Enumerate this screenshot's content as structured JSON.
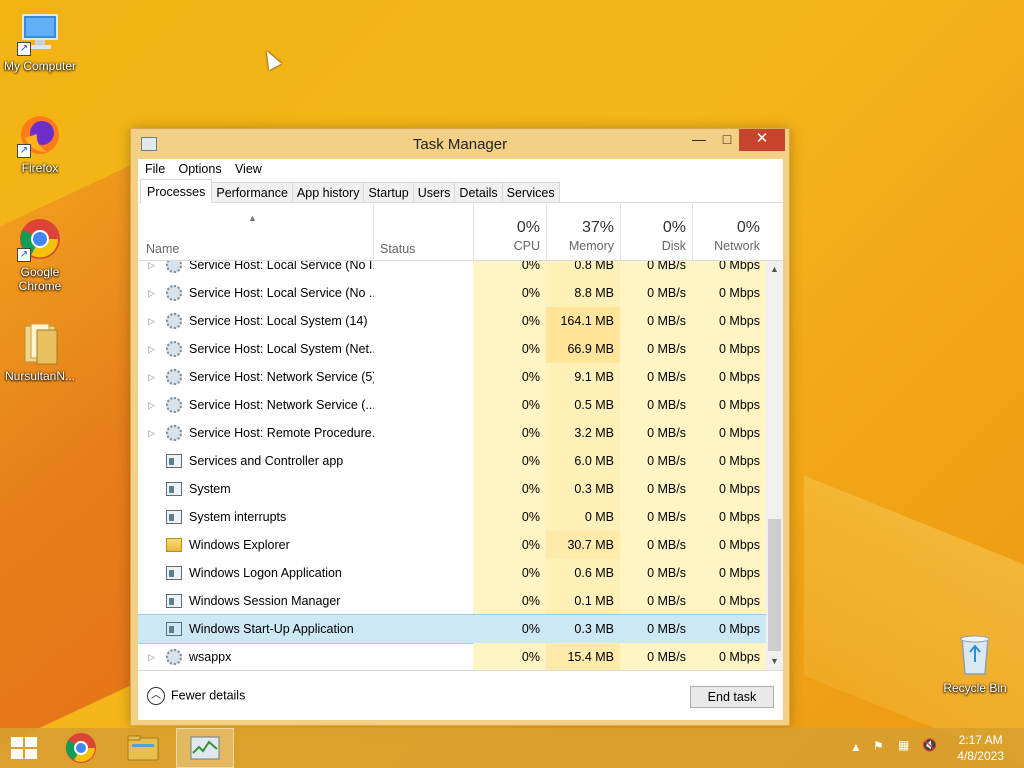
{
  "desktop": {
    "icons": [
      {
        "label": "My Computer",
        "icon": "computer-icon"
      },
      {
        "label": "Firefox",
        "icon": "firefox-icon"
      },
      {
        "label": "Google Chrome",
        "icon": "chrome-icon"
      },
      {
        "label": "NursultanN...",
        "icon": "folder-icon"
      },
      {
        "label": "Recycle Bin",
        "icon": "recycle-bin-icon"
      }
    ]
  },
  "window": {
    "title": "Task Manager",
    "controls": {
      "minimize": "—",
      "maximize": "□",
      "close": "✕"
    },
    "menu": [
      "File",
      "Options",
      "View"
    ],
    "tabs": [
      "Processes",
      "Performance",
      "App history",
      "Startup",
      "Users",
      "Details",
      "Services"
    ],
    "active_tab": "Processes",
    "columns": {
      "name": "Name",
      "status": "Status",
      "cpu": {
        "pct": "0%",
        "label": "CPU"
      },
      "memory": {
        "pct": "37%",
        "label": "Memory"
      },
      "disk": {
        "pct": "0%",
        "label": "Disk"
      },
      "network": {
        "pct": "0%",
        "label": "Network"
      }
    },
    "processes": [
      {
        "name": "Service Host: Local Service (No I...",
        "cpu": "0%",
        "memory": "0.8 MB",
        "disk": "0 MB/s",
        "network": "0 Mbps",
        "icon": "gear-icon",
        "expandable": true
      },
      {
        "name": "Service Host: Local Service (No ...",
        "cpu": "0%",
        "memory": "8.8 MB",
        "disk": "0 MB/s",
        "network": "0 Mbps",
        "icon": "gear-icon",
        "expandable": true
      },
      {
        "name": "Service Host: Local System (14)",
        "cpu": "0%",
        "memory": "164.1 MB",
        "disk": "0 MB/s",
        "network": "0 Mbps",
        "icon": "gear-icon",
        "expandable": true
      },
      {
        "name": "Service Host: Local System (Net...",
        "cpu": "0%",
        "memory": "66.9 MB",
        "disk": "0 MB/s",
        "network": "0 Mbps",
        "icon": "gear-icon",
        "expandable": true
      },
      {
        "name": "Service Host: Network Service (5)",
        "cpu": "0%",
        "memory": "9.1 MB",
        "disk": "0 MB/s",
        "network": "0 Mbps",
        "icon": "gear-icon",
        "expandable": true
      },
      {
        "name": "Service Host: Network Service (...",
        "cpu": "0%",
        "memory": "0.5 MB",
        "disk": "0 MB/s",
        "network": "0 Mbps",
        "icon": "gear-icon",
        "expandable": true
      },
      {
        "name": "Service Host: Remote Procedure...",
        "cpu": "0%",
        "memory": "3.2 MB",
        "disk": "0 MB/s",
        "network": "0 Mbps",
        "icon": "gear-icon",
        "expandable": true
      },
      {
        "name": "Services and Controller app",
        "cpu": "0%",
        "memory": "6.0 MB",
        "disk": "0 MB/s",
        "network": "0 Mbps",
        "icon": "app-window-icon",
        "expandable": false
      },
      {
        "name": "System",
        "cpu": "0%",
        "memory": "0.3 MB",
        "disk": "0 MB/s",
        "network": "0 Mbps",
        "icon": "app-window-icon",
        "expandable": false
      },
      {
        "name": "System interrupts",
        "cpu": "0%",
        "memory": "0 MB",
        "disk": "0 MB/s",
        "network": "0 Mbps",
        "icon": "app-window-icon",
        "expandable": false
      },
      {
        "name": "Windows Explorer",
        "cpu": "0%",
        "memory": "30.7 MB",
        "disk": "0 MB/s",
        "network": "0 Mbps",
        "icon": "folder-icon",
        "expandable": false
      },
      {
        "name": "Windows Logon Application",
        "cpu": "0%",
        "memory": "0.6 MB",
        "disk": "0 MB/s",
        "network": "0 Mbps",
        "icon": "app-window-icon",
        "expandable": false
      },
      {
        "name": "Windows Session Manager",
        "cpu": "0%",
        "memory": "0.1 MB",
        "disk": "0 MB/s",
        "network": "0 Mbps",
        "icon": "app-window-icon",
        "expandable": false
      },
      {
        "name": "Windows Start-Up Application",
        "cpu": "0%",
        "memory": "0.3 MB",
        "disk": "0 MB/s",
        "network": "0 Mbps",
        "icon": "app-window-icon",
        "expandable": false,
        "selected": true
      },
      {
        "name": "wsappx",
        "cpu": "0%",
        "memory": "15.4 MB",
        "disk": "0 MB/s",
        "network": "0 Mbps",
        "icon": "gear-icon",
        "expandable": true
      }
    ],
    "footer": {
      "fewer_details": "Fewer details",
      "end_task": "End task"
    }
  },
  "taskbar": {
    "items": [
      "start-button",
      "chrome-taskbar-button",
      "file-explorer-taskbar-button",
      "task-manager-taskbar-button"
    ],
    "clock": {
      "time": "2:17 AM",
      "date": "4/8/2023"
    }
  }
}
